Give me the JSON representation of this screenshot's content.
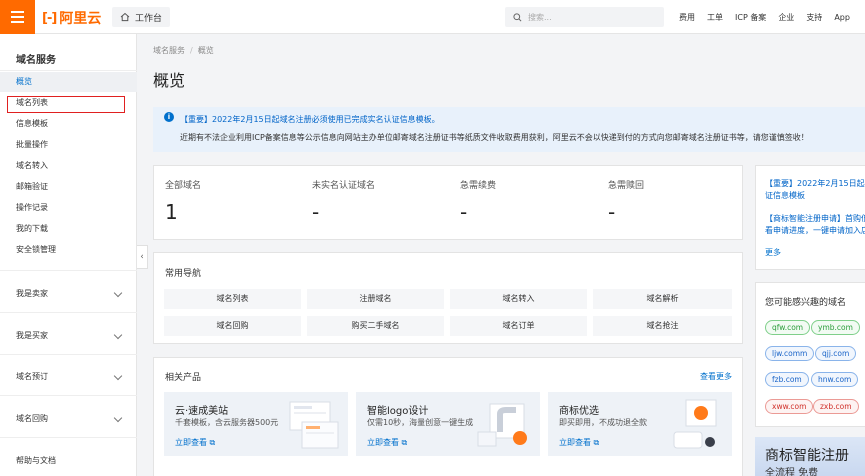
{
  "header": {
    "logo_text": "阿里云",
    "workbench": "工作台",
    "search_placeholder": "搜索...",
    "links": [
      "费用",
      "工单",
      "ICP 备案",
      "企业",
      "支持",
      "App"
    ]
  },
  "sidebar": {
    "title": "域名服务",
    "items": [
      "概览",
      "域名列表",
      "信息模板",
      "批量操作",
      "域名转入",
      "邮箱验证",
      "操作记录",
      "我的下载",
      "安全锁管理"
    ],
    "groups": [
      "我是卖家",
      "我是买家",
      "域名预订",
      "域名回购"
    ],
    "footer": "帮助与文档"
  },
  "breadcrumb": [
    "域名服务",
    "概览"
  ],
  "page_title": "概览",
  "notice": {
    "line1": "【重要】2022年2月15日起域名注册必须使用已完成实名认证信息模板。",
    "line2": "近期有不法企业利用ICP备案信息等公示信息向网站主办单位邮寄域名注册证书等纸质文件收取费用获利，阿里云不会以快递到付的方式向您邮寄域名注册证书等，请您谨慎签收！"
  },
  "stats": [
    {
      "label": "全部域名",
      "value": "1"
    },
    {
      "label": "未实名认证域名",
      "value": "-"
    },
    {
      "label": "急需续费",
      "value": "-"
    },
    {
      "label": "急需赎回",
      "value": "-"
    }
  ],
  "quick_nav": {
    "title": "常用导航",
    "items": [
      "域名列表",
      "注册域名",
      "域名转入",
      "域名解析",
      "域名回购",
      "购买二手域名",
      "域名订单",
      "域名抢注"
    ]
  },
  "products": {
    "title": "相关产品",
    "more": "查看更多",
    "items": [
      {
        "title": "云·速成美站",
        "desc": "千套模板，含云服务器500元",
        "link": "立即查看"
      },
      {
        "title": "智能logo设计",
        "desc": "仅需10秒，海量创意一键生成",
        "link": "立即查看"
      },
      {
        "title": "商标优选",
        "desc": "即买即用，不成功退全款",
        "link": "立即查看"
      }
    ]
  },
  "right_news": {
    "item1_l1": "【重要】2022年2月15日起",
    "item1_l2": "证信息模板",
    "item2_l1": "【商标智能注册申请】首购低",
    "item2_l2": "看申请进度，一键申请加入店",
    "more": "更多"
  },
  "suggest": {
    "title": "您可能感兴趣的域名",
    "tags": [
      "qfw.com",
      "ymb.com",
      "ljw.comm",
      "qjj.com",
      "fzb.com",
      "hnw.com",
      "xww.com",
      "zxb.com"
    ]
  },
  "banner": {
    "title": "商标智能注册",
    "subtitle": "全流程 免费"
  },
  "colors": {
    "brand": "#ff6a00",
    "link": "#0070cc",
    "notice_bg": "#e8f1fb",
    "highlight_border": "#e02020"
  }
}
